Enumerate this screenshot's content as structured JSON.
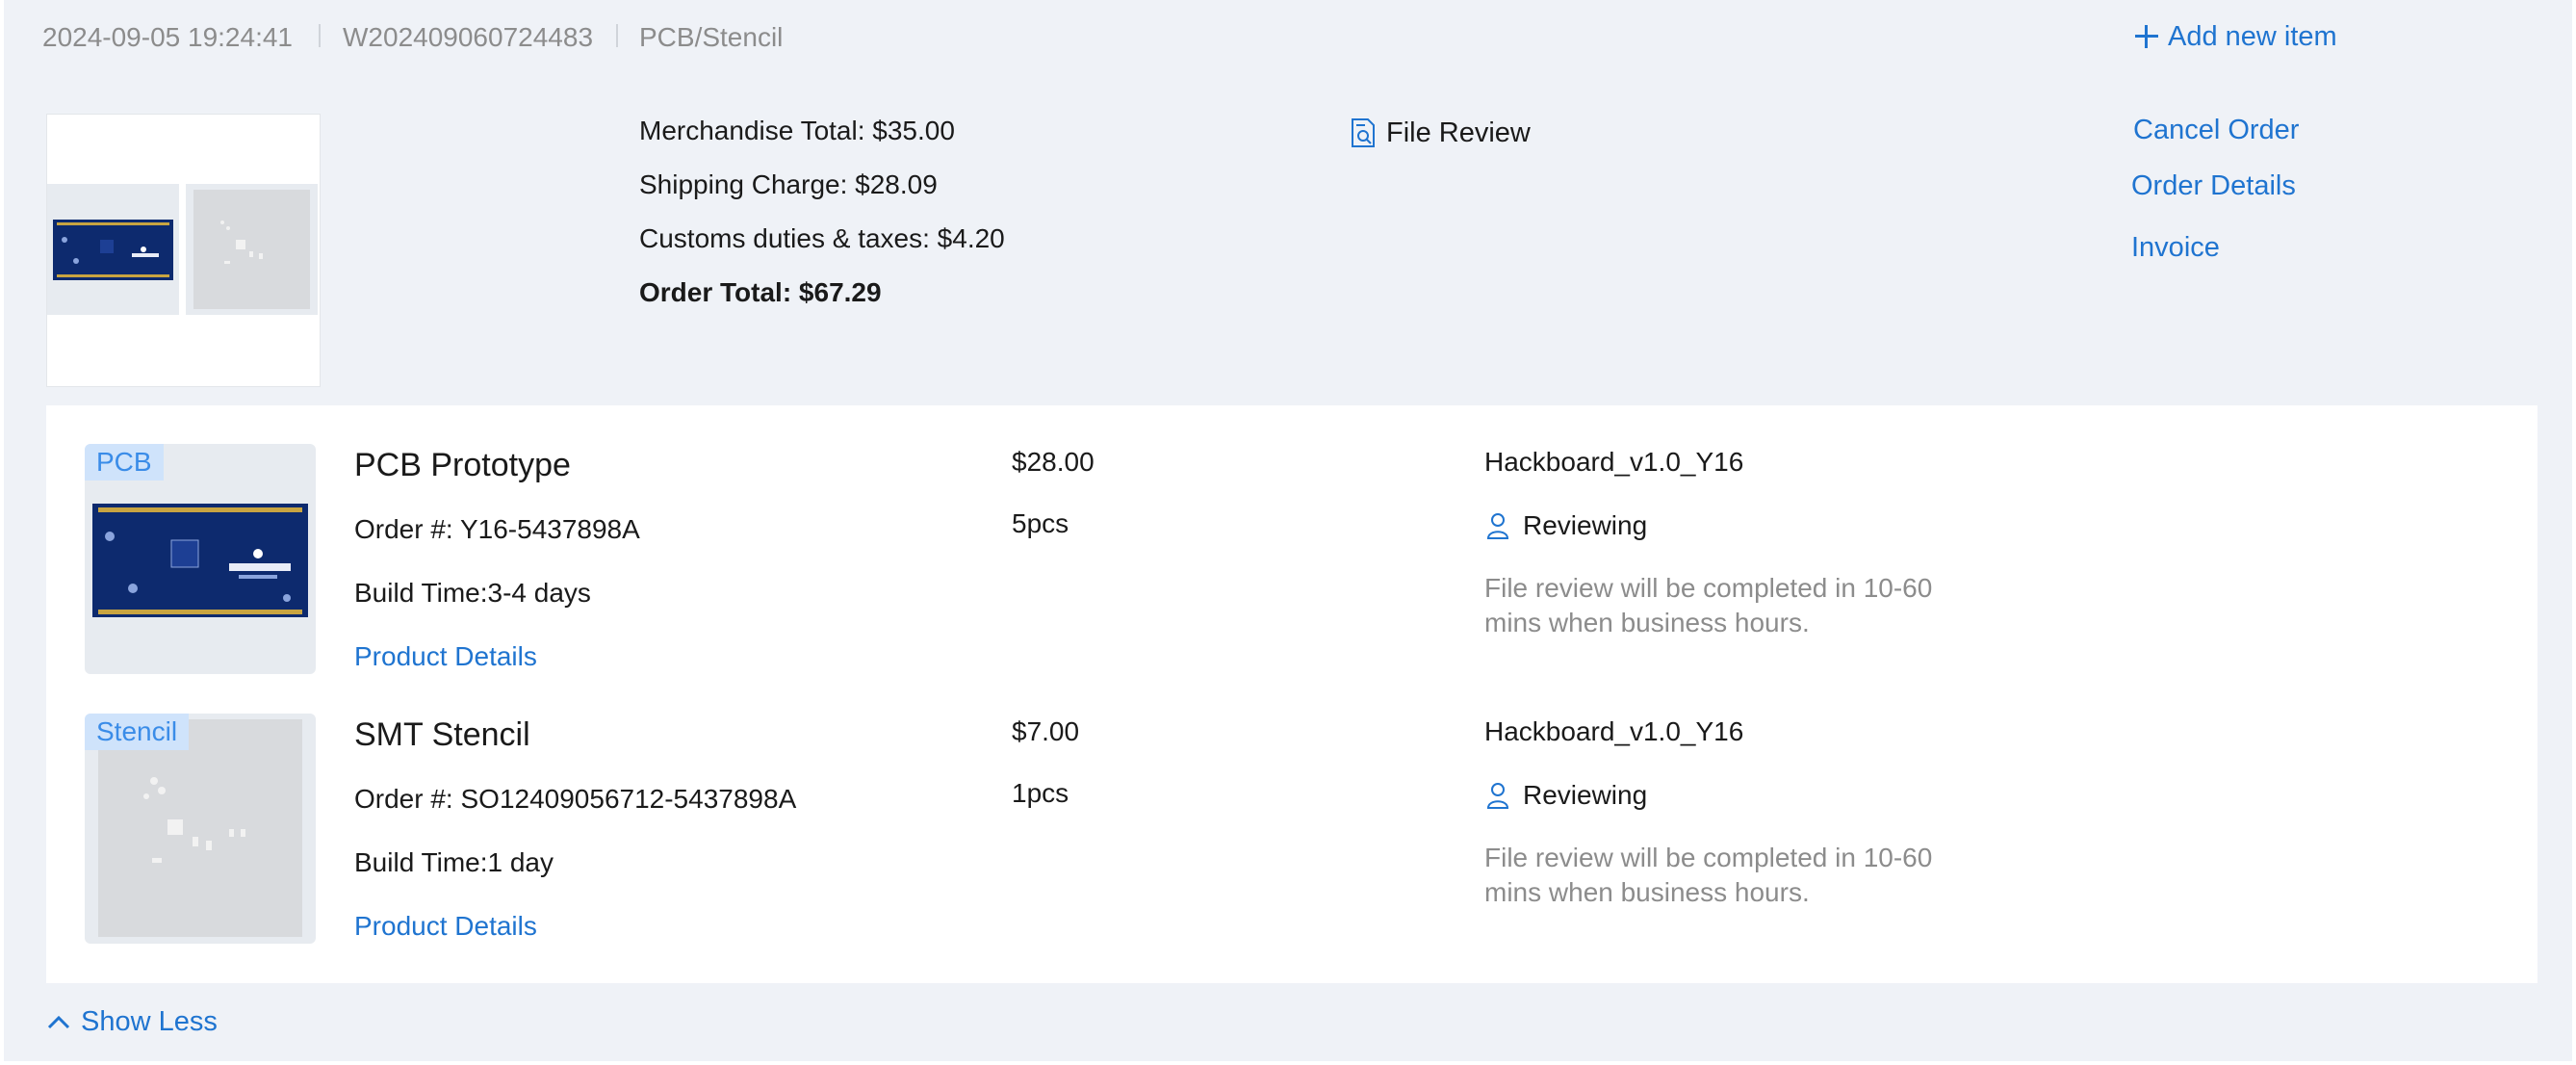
{
  "header": {
    "datetime": "2024-09-05 19:24:41",
    "order_no": "W202409060724483",
    "category": "PCB/Stencil",
    "add_new_item": "Add new item"
  },
  "summary": {
    "merchandise_total": "Merchandise Total: $35.00",
    "shipping_charge": "Shipping Charge: $28.09",
    "customs": "Customs duties & taxes: $4.20",
    "order_total": "Order Total: $67.29",
    "file_review": "File Review"
  },
  "actions": {
    "cancel_order": "Cancel Order",
    "order_details": "Order Details",
    "invoice": "Invoice"
  },
  "items": [
    {
      "tag": "PCB",
      "name": "PCB Prototype",
      "order_no": "Order #: Y16-5437898A",
      "build_time": "Build Time:3-4 days",
      "details_link": "Product Details",
      "price": "$28.00",
      "qty": "5pcs",
      "file_name": "Hackboard_v1.0_Y16",
      "status": "Reviewing",
      "note": "File review will be completed in 10-60 mins when business hours."
    },
    {
      "tag": "Stencil",
      "name": "SMT Stencil",
      "order_no": "Order #: SO12409056712-5437898A",
      "build_time": "Build Time:1 day",
      "details_link": "Product Details",
      "price": "$7.00",
      "qty": "1pcs",
      "file_name": "Hackboard_v1.0_Y16",
      "status": "Reviewing",
      "note": "File review will be completed in 10-60 mins when business hours."
    }
  ],
  "footer": {
    "show_less": "Show Less"
  },
  "colors": {
    "accent": "#1f74d0",
    "background": "#eff2f7",
    "pcb_board": "#0d2a6e",
    "tag_bg": "#cfe3fb"
  },
  "icons": [
    "plus-icon",
    "file-review-icon",
    "reviewer-icon",
    "chevron-up-icon"
  ]
}
